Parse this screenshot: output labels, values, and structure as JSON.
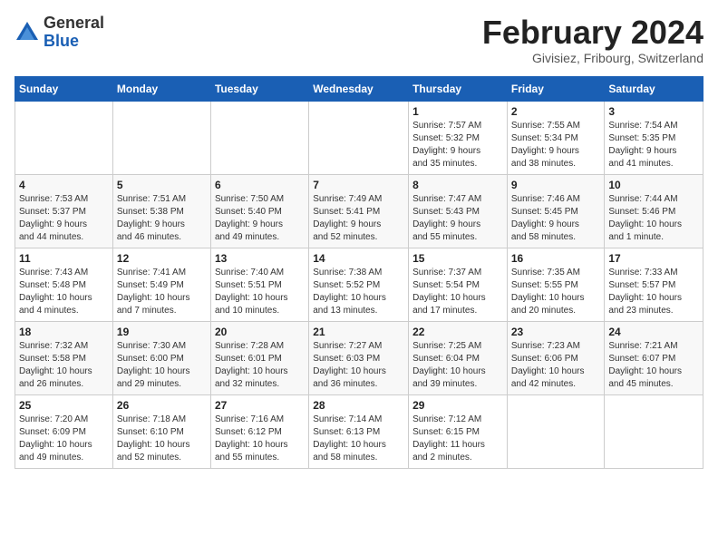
{
  "header": {
    "logo_general": "General",
    "logo_blue": "Blue",
    "month_title": "February 2024",
    "location": "Givisiez, Fribourg, Switzerland"
  },
  "weekdays": [
    "Sunday",
    "Monday",
    "Tuesday",
    "Wednesday",
    "Thursday",
    "Friday",
    "Saturday"
  ],
  "weeks": [
    [
      {
        "day": "",
        "detail": ""
      },
      {
        "day": "",
        "detail": ""
      },
      {
        "day": "",
        "detail": ""
      },
      {
        "day": "",
        "detail": ""
      },
      {
        "day": "1",
        "detail": "Sunrise: 7:57 AM\nSunset: 5:32 PM\nDaylight: 9 hours\nand 35 minutes."
      },
      {
        "day": "2",
        "detail": "Sunrise: 7:55 AM\nSunset: 5:34 PM\nDaylight: 9 hours\nand 38 minutes."
      },
      {
        "day": "3",
        "detail": "Sunrise: 7:54 AM\nSunset: 5:35 PM\nDaylight: 9 hours\nand 41 minutes."
      }
    ],
    [
      {
        "day": "4",
        "detail": "Sunrise: 7:53 AM\nSunset: 5:37 PM\nDaylight: 9 hours\nand 44 minutes."
      },
      {
        "day": "5",
        "detail": "Sunrise: 7:51 AM\nSunset: 5:38 PM\nDaylight: 9 hours\nand 46 minutes."
      },
      {
        "day": "6",
        "detail": "Sunrise: 7:50 AM\nSunset: 5:40 PM\nDaylight: 9 hours\nand 49 minutes."
      },
      {
        "day": "7",
        "detail": "Sunrise: 7:49 AM\nSunset: 5:41 PM\nDaylight: 9 hours\nand 52 minutes."
      },
      {
        "day": "8",
        "detail": "Sunrise: 7:47 AM\nSunset: 5:43 PM\nDaylight: 9 hours\nand 55 minutes."
      },
      {
        "day": "9",
        "detail": "Sunrise: 7:46 AM\nSunset: 5:45 PM\nDaylight: 9 hours\nand 58 minutes."
      },
      {
        "day": "10",
        "detail": "Sunrise: 7:44 AM\nSunset: 5:46 PM\nDaylight: 10 hours\nand 1 minute."
      }
    ],
    [
      {
        "day": "11",
        "detail": "Sunrise: 7:43 AM\nSunset: 5:48 PM\nDaylight: 10 hours\nand 4 minutes."
      },
      {
        "day": "12",
        "detail": "Sunrise: 7:41 AM\nSunset: 5:49 PM\nDaylight: 10 hours\nand 7 minutes."
      },
      {
        "day": "13",
        "detail": "Sunrise: 7:40 AM\nSunset: 5:51 PM\nDaylight: 10 hours\nand 10 minutes."
      },
      {
        "day": "14",
        "detail": "Sunrise: 7:38 AM\nSunset: 5:52 PM\nDaylight: 10 hours\nand 13 minutes."
      },
      {
        "day": "15",
        "detail": "Sunrise: 7:37 AM\nSunset: 5:54 PM\nDaylight: 10 hours\nand 17 minutes."
      },
      {
        "day": "16",
        "detail": "Sunrise: 7:35 AM\nSunset: 5:55 PM\nDaylight: 10 hours\nand 20 minutes."
      },
      {
        "day": "17",
        "detail": "Sunrise: 7:33 AM\nSunset: 5:57 PM\nDaylight: 10 hours\nand 23 minutes."
      }
    ],
    [
      {
        "day": "18",
        "detail": "Sunrise: 7:32 AM\nSunset: 5:58 PM\nDaylight: 10 hours\nand 26 minutes."
      },
      {
        "day": "19",
        "detail": "Sunrise: 7:30 AM\nSunset: 6:00 PM\nDaylight: 10 hours\nand 29 minutes."
      },
      {
        "day": "20",
        "detail": "Sunrise: 7:28 AM\nSunset: 6:01 PM\nDaylight: 10 hours\nand 32 minutes."
      },
      {
        "day": "21",
        "detail": "Sunrise: 7:27 AM\nSunset: 6:03 PM\nDaylight: 10 hours\nand 36 minutes."
      },
      {
        "day": "22",
        "detail": "Sunrise: 7:25 AM\nSunset: 6:04 PM\nDaylight: 10 hours\nand 39 minutes."
      },
      {
        "day": "23",
        "detail": "Sunrise: 7:23 AM\nSunset: 6:06 PM\nDaylight: 10 hours\nand 42 minutes."
      },
      {
        "day": "24",
        "detail": "Sunrise: 7:21 AM\nSunset: 6:07 PM\nDaylight: 10 hours\nand 45 minutes."
      }
    ],
    [
      {
        "day": "25",
        "detail": "Sunrise: 7:20 AM\nSunset: 6:09 PM\nDaylight: 10 hours\nand 49 minutes."
      },
      {
        "day": "26",
        "detail": "Sunrise: 7:18 AM\nSunset: 6:10 PM\nDaylight: 10 hours\nand 52 minutes."
      },
      {
        "day": "27",
        "detail": "Sunrise: 7:16 AM\nSunset: 6:12 PM\nDaylight: 10 hours\nand 55 minutes."
      },
      {
        "day": "28",
        "detail": "Sunrise: 7:14 AM\nSunset: 6:13 PM\nDaylight: 10 hours\nand 58 minutes."
      },
      {
        "day": "29",
        "detail": "Sunrise: 7:12 AM\nSunset: 6:15 PM\nDaylight: 11 hours\nand 2 minutes."
      },
      {
        "day": "",
        "detail": ""
      },
      {
        "day": "",
        "detail": ""
      }
    ]
  ]
}
